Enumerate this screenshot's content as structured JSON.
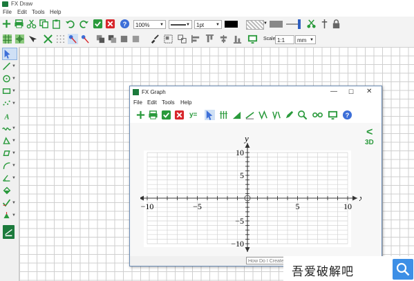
{
  "app": {
    "title": "FX Draw"
  },
  "menu": [
    "File",
    "Edit",
    "Tools",
    "Help"
  ],
  "toolbar": {
    "zoom": "100%",
    "line_width": "1pt",
    "scale_label": "Scale",
    "scale_value": "1:1",
    "scale_unit": "mm"
  },
  "graph_window": {
    "title": "FX Graph",
    "menu": [
      "File",
      "Edit",
      "Tools",
      "Help"
    ],
    "equation_button": "y=",
    "side_label_3d": "3D",
    "help_search_placeholder": "How Do I Create?",
    "axes": {
      "xlabel": "x",
      "ylabel": "y",
      "xticks": [
        "−10",
        "−5",
        "5",
        "10"
      ],
      "yticks": [
        "10",
        "5",
        "−5",
        "−10"
      ],
      "xlim": [
        -10,
        10
      ],
      "ylim": [
        -10,
        10
      ]
    }
  },
  "watermark": {
    "text": "吾爱破解吧"
  },
  "colors": {
    "green": "#2a9a3c",
    "red": "#d7262b",
    "blue": "#3d6fd8"
  }
}
